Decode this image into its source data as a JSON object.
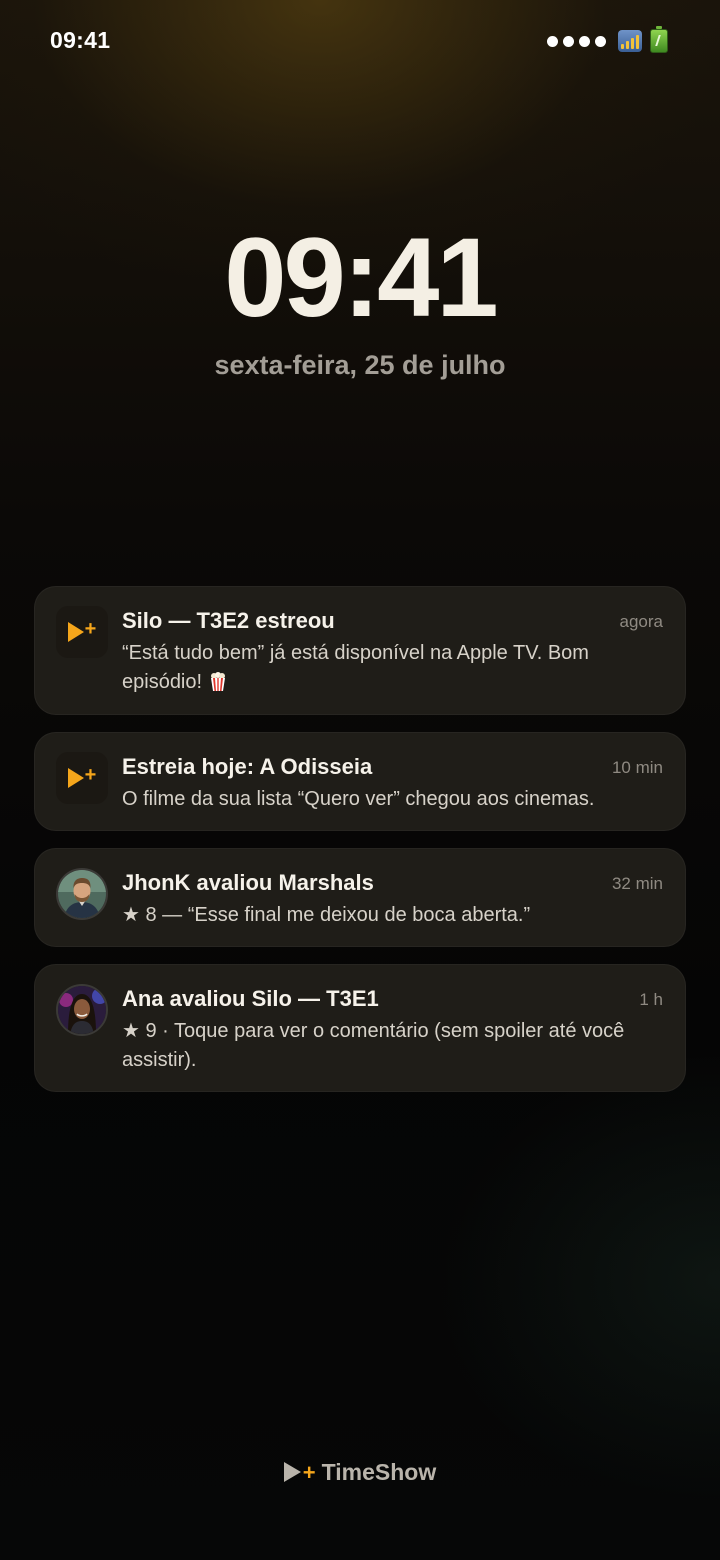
{
  "status_bar": {
    "time": "09:41",
    "signal_dots": 4,
    "icons": [
      "signal-icon",
      "battery-icon"
    ]
  },
  "lock": {
    "time": "09:41",
    "date": "sexta-feira, 25 de julho"
  },
  "notifications": [
    {
      "icon": "app-icon",
      "title": "Silo — T3E2 estreou",
      "time": "agora",
      "body": "“Está tudo bem” já está disponível na Apple TV. Bom episódio!",
      "emoji": "popcorn-icon"
    },
    {
      "icon": "app-icon",
      "title": "Estreia hoje: A Odisseia",
      "time": "10 min",
      "body": "O filme da sua lista “Quero ver” chegou aos cinemas."
    },
    {
      "icon": "avatar-jhonk",
      "title": "JhonK avaliou Marshals",
      "time": "32 min",
      "body": "★ 8 — “Esse final me deixou de boca aberta.”"
    },
    {
      "icon": "avatar-ana",
      "title": "Ana avaliou Silo — T3E1",
      "time": "1 h",
      "body": "★ 9 · Toque para ver o comentário (sem spoiler até você assistir)."
    }
  ],
  "brand": {
    "plus": "+",
    "name": "TimeShow"
  },
  "colors": {
    "accent": "#f5a61b",
    "card": "#221f1a",
    "muted_text": "#8f8a82"
  }
}
